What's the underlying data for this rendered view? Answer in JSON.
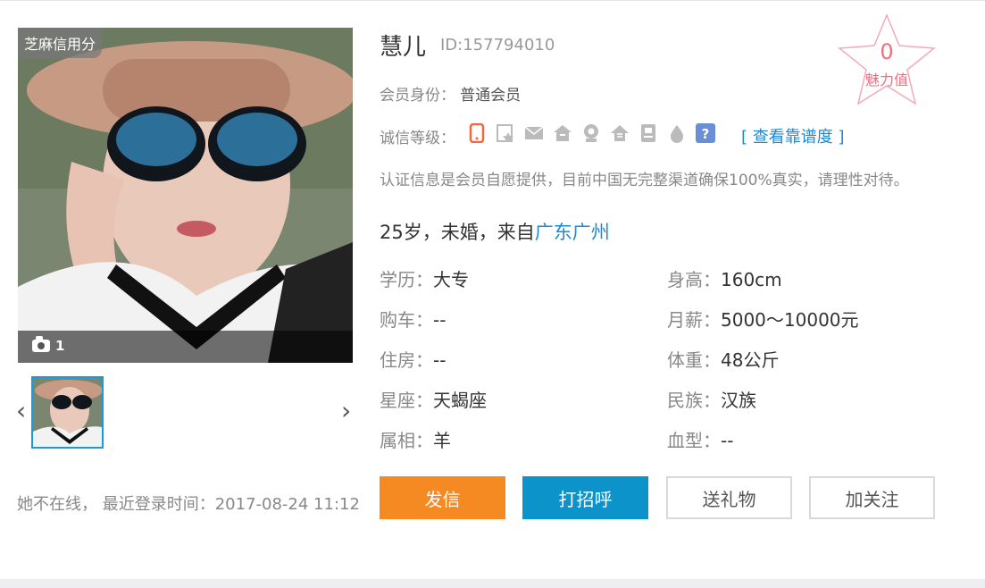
{
  "photo": {
    "badge": "芝麻信用分",
    "count": "1"
  },
  "profile": {
    "name": "慧儿",
    "id": "ID:157794010",
    "member_label": "会员身份：",
    "member_value": "普通会员",
    "credit_label": "诚信等级：",
    "credit_link": "[ 查看靠谱度 ]",
    "notice": "认证信息是会员自愿提供，目前中国无完整渠道确保100%真实，请理性对待。",
    "summary_prefix": "25岁，未婚，来自",
    "summary_location": "广东广州"
  },
  "charm": {
    "value": "0",
    "label": "魅力值",
    "color": "#f36d7e"
  },
  "details": [
    {
      "key": "学历：",
      "value": "大专"
    },
    {
      "key": "购车：",
      "value": "--"
    },
    {
      "key": "住房：",
      "value": "--"
    },
    {
      "key": "星座：",
      "value": "天蝎座"
    },
    {
      "key": "属相：",
      "value": "羊"
    }
  ],
  "details_right": [
    {
      "key": "身高：",
      "value": "160cm"
    },
    {
      "key": "月薪：",
      "value": "5000～10000元"
    },
    {
      "key": "体重：",
      "value": "48公斤"
    },
    {
      "key": "民族：",
      "value": "汉族"
    },
    {
      "key": "血型：",
      "value": "--"
    }
  ],
  "actions": {
    "send_letter": "发信",
    "greet": "打招呼",
    "send_gift": "送礼物",
    "follow": "加关注"
  },
  "status": "她不在线， 最近登录时间：2017-08-24 11:12",
  "colors": {
    "accent_blue": "#1c8ad8",
    "button_orange": "#f58a22",
    "button_blue": "#0c93c9"
  },
  "credit_icons": [
    "phone-icon",
    "certificate-icon",
    "mail-icon",
    "house-icon",
    "video-icon",
    "home-icon",
    "id-card-icon",
    "drop-icon",
    "question-icon"
  ]
}
